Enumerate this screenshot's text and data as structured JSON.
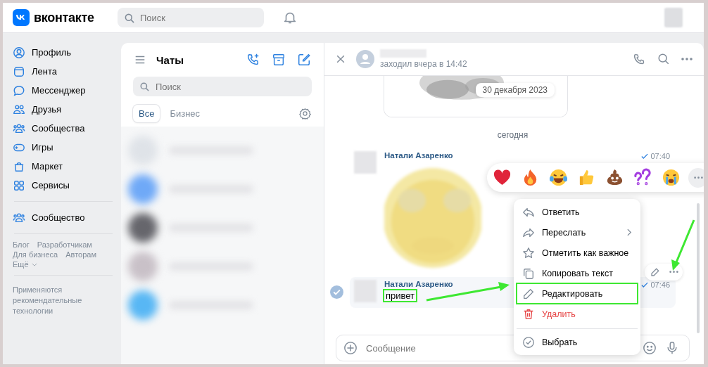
{
  "app": {
    "logo_text": "вконтакте",
    "search": {
      "placeholder": "Поиск"
    }
  },
  "sidebar": {
    "items": [
      {
        "label": "Профиль"
      },
      {
        "label": "Лента"
      },
      {
        "label": "Мессенджер"
      },
      {
        "label": "Друзья"
      },
      {
        "label": "Сообщества"
      },
      {
        "label": "Игры"
      },
      {
        "label": "Маркет"
      },
      {
        "label": "Сервисы"
      }
    ],
    "community": {
      "label": "Сообщество"
    },
    "footer_links": [
      "Блог",
      "Разработчикам",
      "Для бизнеса",
      "Авторам",
      "Ещё"
    ],
    "note": "Применяются рекомендательные технологии"
  },
  "chats_panel": {
    "title": "Чаты",
    "search": {
      "placeholder": "Поиск"
    },
    "tabs": [
      {
        "label": "Все",
        "selected": true
      },
      {
        "label": "Бизнес",
        "selected": false
      }
    ],
    "chats": [
      {
        "color": "#dfe3e8"
      },
      {
        "color": "#6fa9f7"
      },
      {
        "color": "#66666c"
      },
      {
        "color": "#c9c1c8"
      },
      {
        "color": "#58b7f4"
      }
    ]
  },
  "conversation": {
    "status": "заходил вчера в 14:42",
    "date_badge": "30 декабря 2023",
    "day_divider": "сегодня",
    "messages": [
      {
        "author": "Натали Азаренко",
        "time": "07:40",
        "read": true,
        "selected": false
      },
      {
        "kind": "text",
        "author": "Натали Азаренко",
        "text": "привет",
        "time": "07:46",
        "read": true,
        "selected": true,
        "highlighted": true
      }
    ],
    "composer": {
      "placeholder": "Сообщение"
    }
  },
  "context_menu": {
    "items": [
      {
        "label": "Ответить",
        "danger": false,
        "submenu": false,
        "highlighted": false,
        "divider_before": false
      },
      {
        "label": "Переслать",
        "danger": false,
        "submenu": true,
        "highlighted": false,
        "divider_before": false
      },
      {
        "label": "Отметить как важное",
        "danger": false,
        "submenu": false,
        "highlighted": false,
        "divider_before": false
      },
      {
        "label": "Копировать текст",
        "danger": false,
        "submenu": false,
        "highlighted": false,
        "divider_before": false
      },
      {
        "label": "Редактировать",
        "danger": false,
        "submenu": false,
        "highlighted": true,
        "divider_before": false
      },
      {
        "label": "Удалить",
        "danger": true,
        "submenu": false,
        "highlighted": false,
        "divider_before": false
      },
      {
        "label": "Выбрать",
        "danger": false,
        "submenu": false,
        "highlighted": false,
        "divider_before": true
      }
    ]
  }
}
